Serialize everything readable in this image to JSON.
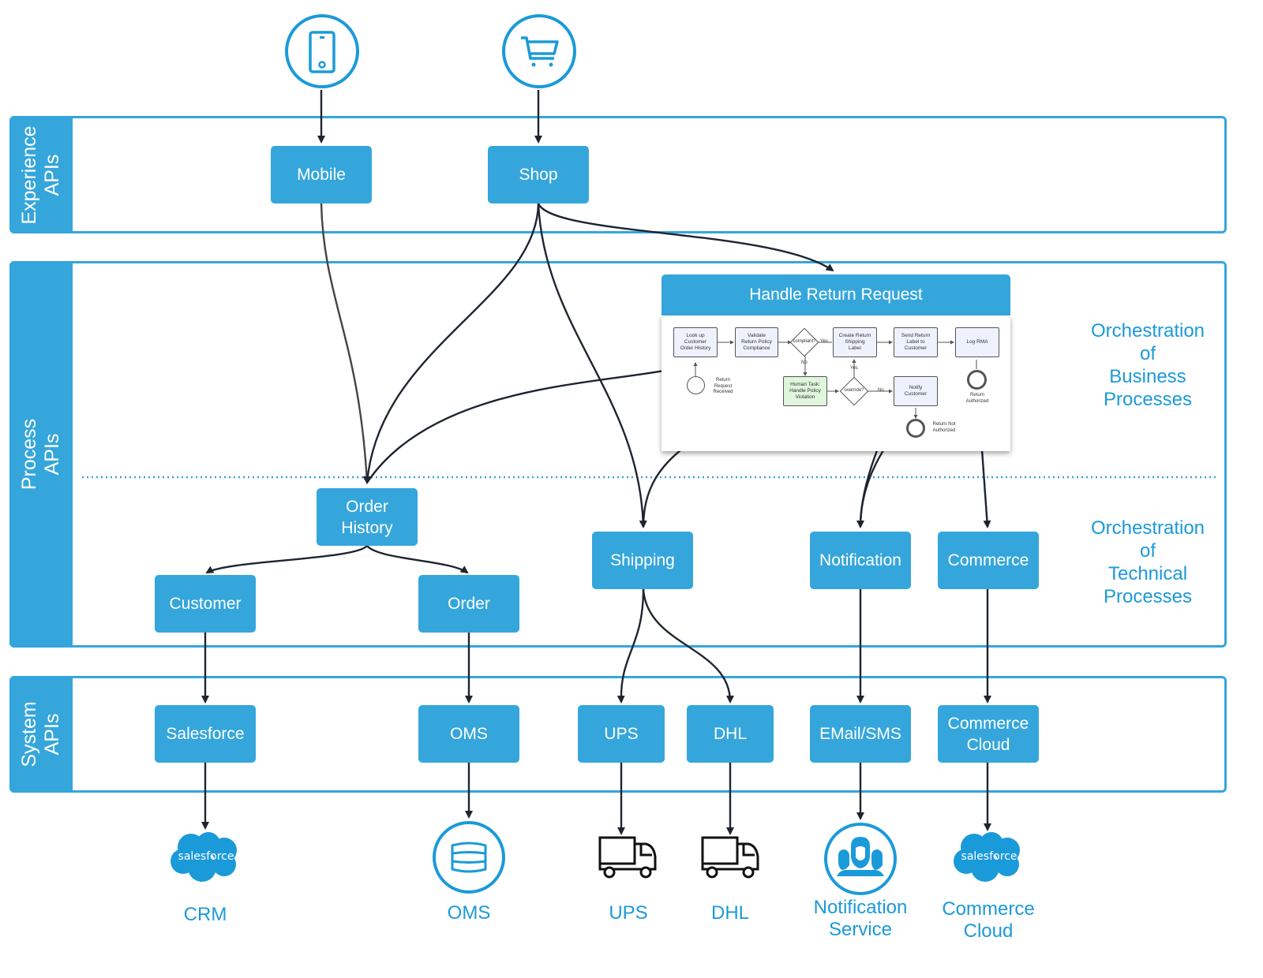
{
  "diagram": {
    "lanes": [
      {
        "id": "experience",
        "title": "Experience\nAPIs"
      },
      {
        "id": "process",
        "title": "Process\nAPIs"
      },
      {
        "id": "system",
        "title": "System\nAPIs"
      }
    ],
    "channels": [
      {
        "id": "mobile-channel",
        "icon": "mobile-phone-icon"
      },
      {
        "id": "shop-channel",
        "icon": "shopping-cart-icon"
      }
    ],
    "experience_nodes": {
      "mobile": "Mobile",
      "shop": "Shop"
    },
    "process_nodes": {
      "handle_return": "Handle Return Request",
      "order_history": "Order\nHistory",
      "customer": "Customer",
      "order": "Order",
      "shipping": "Shipping",
      "notification": "Notification",
      "commerce": "Commerce"
    },
    "system_nodes": {
      "salesforce": "Salesforce",
      "oms": "OMS",
      "ups": "UPS",
      "dhl": "DHL",
      "email_sms": "EMail/SMS",
      "commerce_cloud": "Commerce\nCloud"
    },
    "side_notes": {
      "business": "Orchestration\nof\nBusiness\nProcesses",
      "technical": "Orchestration\nof\nTechnical\nProcesses"
    },
    "external_systems": [
      {
        "id": "crm",
        "label": "CRM",
        "icon": "salesforce-cloud-icon",
        "icon_text": "salesforce"
      },
      {
        "id": "oms",
        "label": "OMS",
        "icon": "database-icon"
      },
      {
        "id": "ups",
        "label": "UPS",
        "icon": "truck-icon"
      },
      {
        "id": "dhl",
        "label": "DHL",
        "icon": "truck-icon"
      },
      {
        "id": "notification-service",
        "label": "Notification\nService",
        "icon": "people-group-icon"
      },
      {
        "id": "commerce-cloud",
        "label": "Commerce\nCloud",
        "icon": "salesforce-cloud-icon",
        "icon_text": "salesforce"
      }
    ],
    "bpmn": {
      "tasks": {
        "lookup": "Look up\nCustomer\nOrder History",
        "validate": "Validate\nReturn Policy\nCompliance",
        "create_label": "Create Return\nShipping\nLabel",
        "send_label": "Send Return\nLabel to\nCustomer",
        "log_rma": "Log RMA",
        "human_task": "Human Task:\nHandle Policy\nViolation",
        "notify": "Notify\nCustomer"
      },
      "gateways": {
        "compliant": "compliant?",
        "override": "override?"
      },
      "flow_labels": {
        "yes1": "Yes",
        "no1": "No",
        "yes2": "Yes",
        "no2": "No"
      },
      "events": {
        "start": "Return\nRequest\nReceived",
        "authorized": "Return\nAuthorized",
        "not_authorized": "Return Not\nAuthorized"
      }
    },
    "colors": {
      "primary": "#35a6dc",
      "label_text": "#1b9ad9",
      "edge": "#1e2530"
    }
  }
}
